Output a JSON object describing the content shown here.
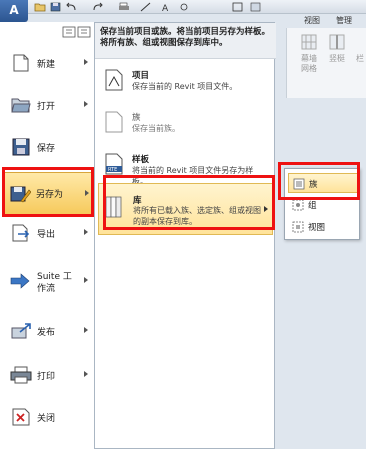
{
  "toolbar": {
    "app_letter": "A",
    "icons": [
      "open-icon",
      "save-icon",
      "undo-icon",
      "redo-icon",
      "print-icon",
      "measure-icon",
      "text-icon"
    ]
  },
  "ribbon": {
    "tabs": [
      "视图",
      "管理"
    ],
    "labels": [
      "幕墙\n网格",
      "竖梃",
      "栏"
    ]
  },
  "left_menu": {
    "items": [
      {
        "label": "新建",
        "icon": "new-document-icon",
        "has_arrow": true
      },
      {
        "label": "打开",
        "icon": "open-folder-icon",
        "has_arrow": true
      },
      {
        "label": "保存",
        "icon": "save-disk-icon",
        "has_arrow": false
      },
      {
        "label": "另存为",
        "icon": "save-as-icon",
        "has_arrow": true,
        "selected": true
      },
      {
        "label": "导出",
        "icon": "export-icon",
        "has_arrow": true
      },
      {
        "label": "Suite 工作流",
        "icon": "suite-workflow-icon",
        "has_arrow": true
      },
      {
        "label": "发布",
        "icon": "publish-icon",
        "has_arrow": true
      },
      {
        "label": "打印",
        "icon": "printer-icon",
        "has_arrow": true
      },
      {
        "label": "关闭",
        "icon": "close-document-icon",
        "has_arrow": false
      }
    ]
  },
  "submenu": {
    "header": "保存当前项目或族。将当前项目另存为样板。将所有族、组或视图保存到库中。",
    "items": [
      {
        "title": "项目",
        "desc": "保存当前的 Revit 项目文件。",
        "icon": "project-file-icon"
      },
      {
        "title": "族",
        "desc": "保存当前族。",
        "icon": "family-file-icon"
      },
      {
        "title": "样板",
        "desc": "将当前的 Revit 项目文件另存为样板。",
        "icon": "template-file-icon",
        "badge": "RTE"
      },
      {
        "title": "库",
        "desc": "将所有已载入族、选定族、组或视图的副本保存到库。",
        "icon": "library-books-icon",
        "selected": true
      }
    ]
  },
  "flyout": {
    "items": [
      {
        "label": "族",
        "icon": "family-icon",
        "selected": true
      },
      {
        "label": "组",
        "icon": "group-icon"
      },
      {
        "label": "视图",
        "icon": "view-icon"
      }
    ]
  },
  "colors": {
    "highlight": "#ee1111",
    "selected_bg": "#f6c95a",
    "brand": "#2c5590"
  }
}
